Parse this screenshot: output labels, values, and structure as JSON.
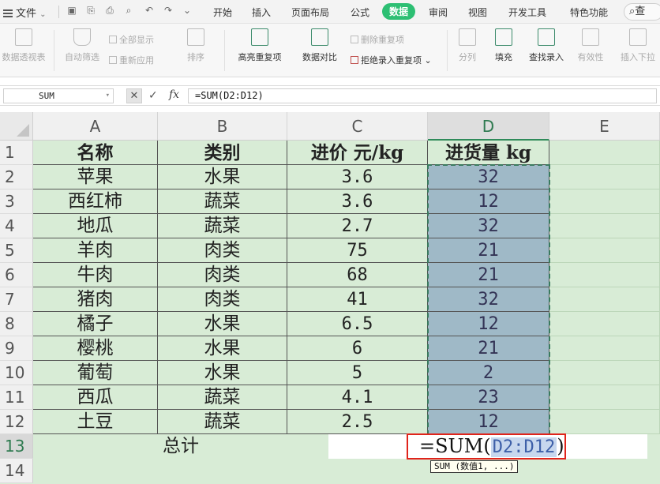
{
  "menubar": {
    "file_label": "文件",
    "tabs": [
      "开始",
      "插入",
      "页面布局",
      "公式",
      "数据",
      "审阅",
      "视图",
      "开发工具",
      "特色功能"
    ],
    "active_tab": "数据",
    "search_label": "查"
  },
  "ribbon": {
    "pivot": "数据透视表",
    "autofilter": "自动筛选",
    "show_all": "全部显示",
    "reapply": "重新应用",
    "sort": "排序",
    "highlight_dup": "高亮重复项",
    "compare": "数据对比",
    "delete_dup": "删除重复项",
    "reject_dup": "拒绝录入重复项",
    "split_col": "分列",
    "fill": "填充",
    "lookup_entry": "查找录入",
    "validity": "有效性",
    "insert_dropdown": "插入下拉"
  },
  "formula_bar": {
    "name_box": "SUM",
    "fx": "fx",
    "formula": "=SUM(D2:D12)"
  },
  "columns": [
    "A",
    "B",
    "C",
    "D",
    "E"
  ],
  "rows": [
    "1",
    "2",
    "3",
    "4",
    "5",
    "6",
    "7",
    "8",
    "9",
    "10",
    "11",
    "12",
    "13",
    "14"
  ],
  "table": {
    "headers": [
      "名称",
      "类别",
      "进价 元/kg",
      "进货量 kg"
    ],
    "rows": [
      [
        "苹果",
        "水果",
        "3.6",
        "32"
      ],
      [
        "西红柿",
        "蔬菜",
        "3.6",
        "12"
      ],
      [
        "地瓜",
        "蔬菜",
        "2.7",
        "32"
      ],
      [
        "羊肉",
        "肉类",
        "75",
        "21"
      ],
      [
        "牛肉",
        "肉类",
        "68",
        "21"
      ],
      [
        "猪肉",
        "肉类",
        "41",
        "32"
      ],
      [
        "橘子",
        "水果",
        "6.5",
        "12"
      ],
      [
        "樱桃",
        "水果",
        "6",
        "21"
      ],
      [
        "葡萄",
        "水果",
        "5",
        "2"
      ],
      [
        "西瓜",
        "蔬菜",
        "4.1",
        "23"
      ],
      [
        "土豆",
        "蔬菜",
        "2.5",
        "12"
      ]
    ],
    "total_label": "总计"
  },
  "edit": {
    "prefix": "=SUM(",
    "ref": "D2:D12",
    "suffix": ")"
  },
  "tooltip": "SUM (数值1, ...)"
}
